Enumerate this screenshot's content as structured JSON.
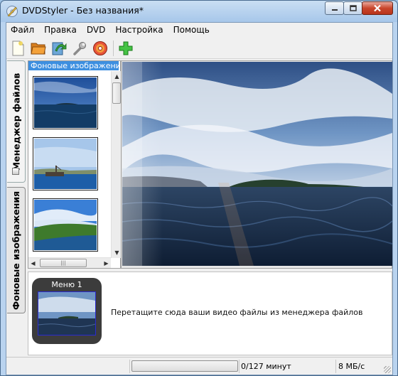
{
  "window": {
    "title": "DVDStyler - Без названия*",
    "controls": [
      "minimize",
      "maximize",
      "close"
    ]
  },
  "menubar": {
    "items": [
      "Файл",
      "Правка",
      "DVD",
      "Настройка",
      "Помощь"
    ]
  },
  "toolbar": {
    "buttons": [
      "new-document-icon",
      "open-folder-icon",
      "save-icon",
      "settings-wrench-icon",
      "burn-disc-icon",
      "add-icon"
    ]
  },
  "side_tabs": {
    "file_manager": "Менеджер файлов",
    "backgrounds": "Фоновые изображения"
  },
  "backgrounds_pane": {
    "title": "Фоновые изображения",
    "thumbnails": [
      "sea-island",
      "harbor-ship",
      "lake-shore"
    ]
  },
  "menus_area": {
    "menu_label": "Меню 1",
    "drop_hint": "Перетащите сюда ваши видео файлы из менеджера файлов"
  },
  "statusbar": {
    "progress": 0,
    "duration_text": "0/127 минут",
    "bitrate_text": "8 МБ/с"
  },
  "colors": {
    "pane_title_bg": "#3d8fe0",
    "menu_card_bg": "#3c3c3c",
    "close_button": "#c9462c"
  }
}
